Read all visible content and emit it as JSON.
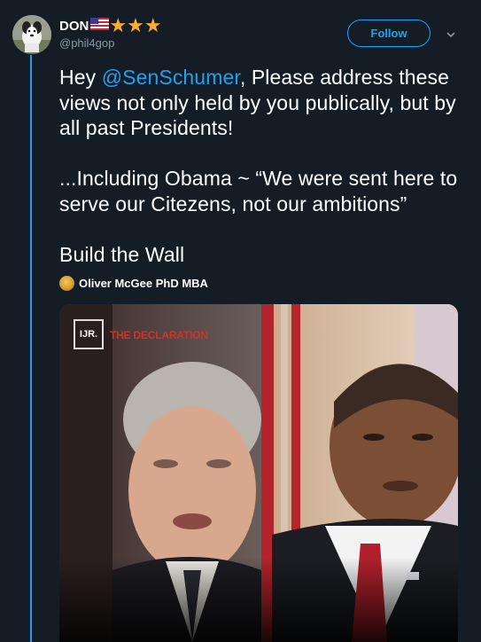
{
  "user": {
    "display_name": "DON",
    "handle": "@phil4gop",
    "badges": [
      "us-flag-icon",
      "star-icon",
      "star-icon",
      "star-icon"
    ]
  },
  "follow_button": {
    "label": "Follow"
  },
  "tweet": {
    "text_prefix": "Hey ",
    "mention": "@SenSchumer",
    "text_rest": ", Please address these views not only held by you publically, but by all past Presidents!",
    "paragraph2": "...Including Obama ~ “We were sent here to serve our Citezens, not our ambitions”",
    "paragraph3": "Build the Wall"
  },
  "attribution": {
    "name": "Oliver McGee PhD MBA"
  },
  "media": {
    "logo_text": "IJR.",
    "caption": "THE DECLARATION"
  },
  "colors": {
    "background": "#141d26",
    "accent": "#1da1f2",
    "text": "#ffffff",
    "muted": "#8899a6",
    "star": "#ffac33"
  }
}
